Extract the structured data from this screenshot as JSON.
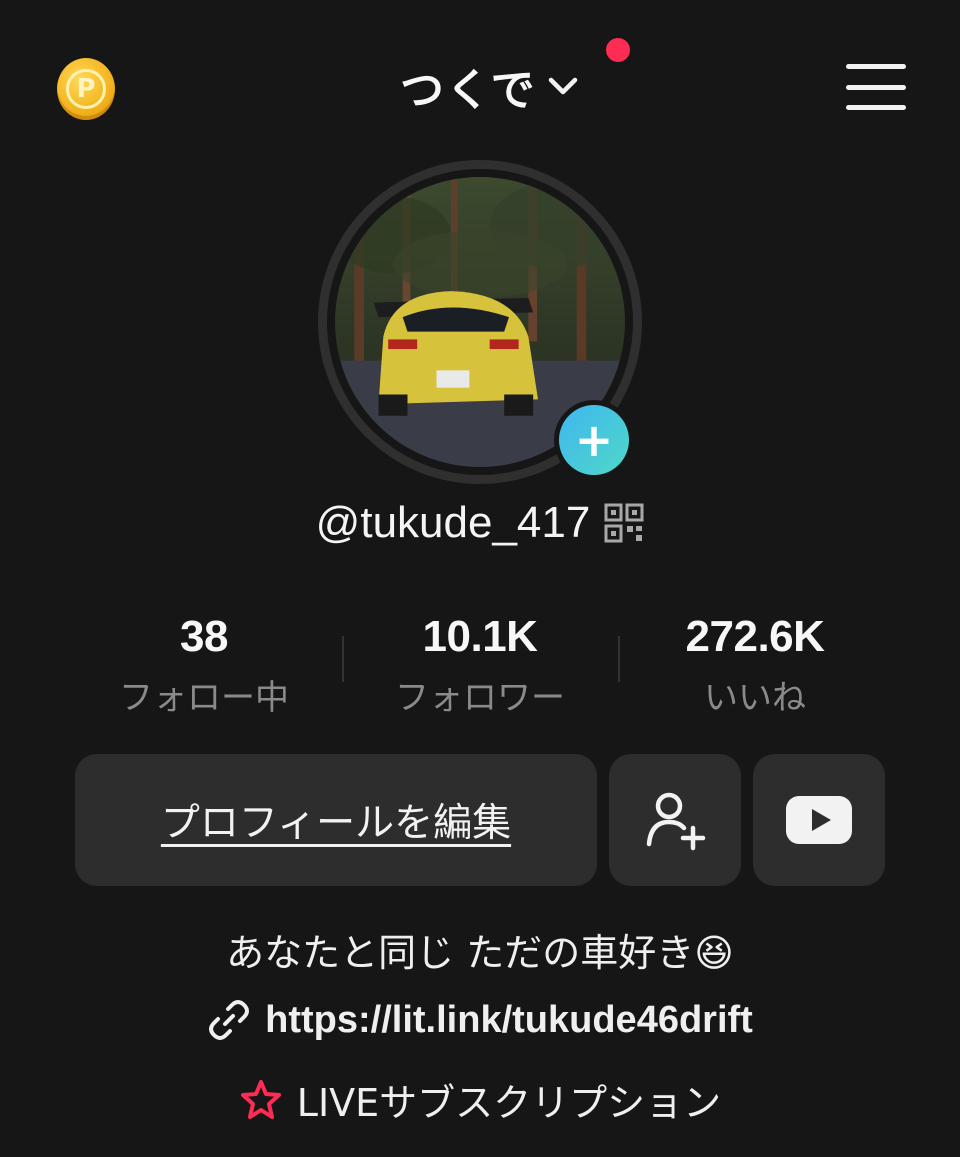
{
  "header": {
    "coin_icon": "points-coin-icon",
    "coin_letter": "P",
    "account_name": "つくで",
    "notification_color": "#fe2c55",
    "menu_icon": "hamburger-menu-icon"
  },
  "profile": {
    "avatar_description_icon": "yellow-car-avatar",
    "add_icon": "plus-icon",
    "username": "@tukude_417"
  },
  "stats": [
    {
      "value": "38",
      "label": "フォロー中"
    },
    {
      "value": "10.1K",
      "label": "フォロワー"
    },
    {
      "value": "272.6K",
      "label": "いいね"
    }
  ],
  "actions": {
    "edit_profile": "プロフィールを編集",
    "add_friend_icon": "add-friend-icon",
    "youtube_icon": "youtube-icon"
  },
  "bio": {
    "text": "あなたと同じ ただの車好き😆",
    "link": "https://lit.link/tukude46drift",
    "subscription": "LIVEサブスクリプション"
  },
  "colors": {
    "background": "#161616",
    "accent": "#fe2c55",
    "button": "#2d2d2d"
  }
}
